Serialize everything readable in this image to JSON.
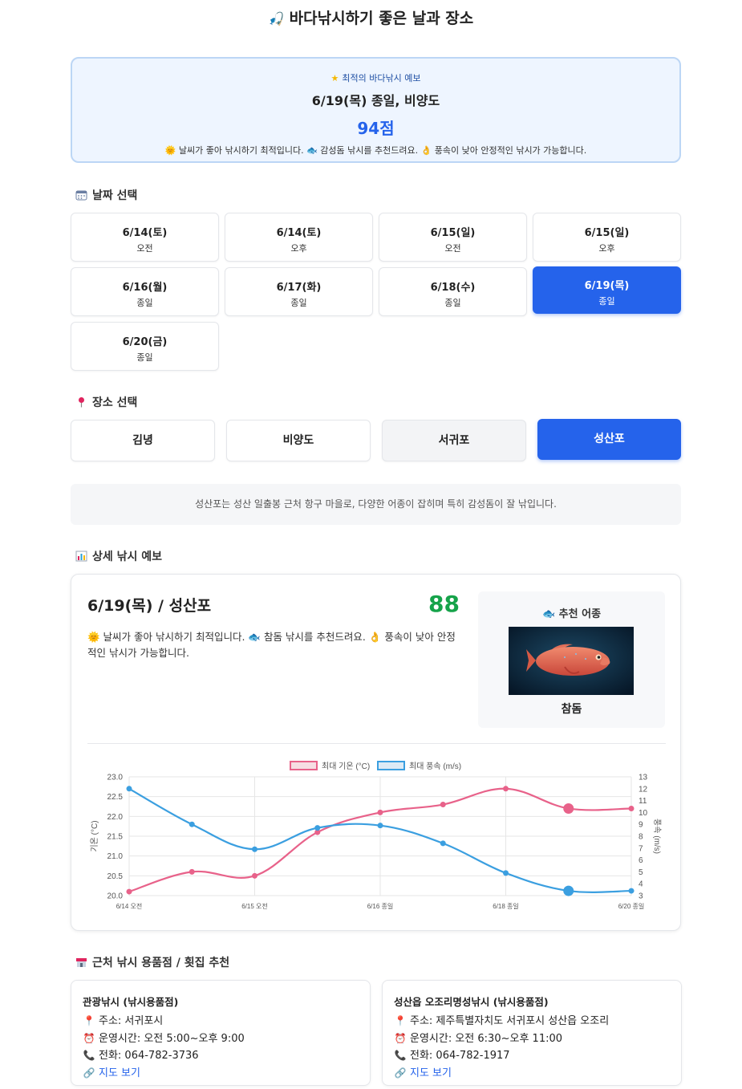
{
  "page": {
    "title": "바다낚시하기 좋은 날과 장소",
    "title_icon": "person-fishing-icon"
  },
  "best": {
    "label": "최적의 바다낚시 예보",
    "title": "6/19(목) 종일, 비양도",
    "score": "94점",
    "desc": "🌞 날씨가 좋아 낚시하기 최적입니다. 🐟 감성돔 낚시를 추천드려요. 👌 풍속이 낮아 안정적인 낚시가 가능합니다."
  },
  "date_section": {
    "title": "날짜 선택"
  },
  "dates": [
    {
      "date": "6/14(토)",
      "time": "오전",
      "active": false
    },
    {
      "date": "6/14(토)",
      "time": "오후",
      "active": false
    },
    {
      "date": "6/15(일)",
      "time": "오전",
      "active": false
    },
    {
      "date": "6/15(일)",
      "time": "오후",
      "active": false
    },
    {
      "date": "6/16(월)",
      "time": "종일",
      "active": false
    },
    {
      "date": "6/17(화)",
      "time": "종일",
      "active": false
    },
    {
      "date": "6/18(수)",
      "time": "종일",
      "active": false
    },
    {
      "date": "6/19(목)",
      "time": "종일",
      "active": true
    },
    {
      "date": "6/20(금)",
      "time": "종일",
      "active": false
    }
  ],
  "location_section": {
    "title": "장소 선택"
  },
  "locations": [
    {
      "name": "김녕",
      "state": "default"
    },
    {
      "name": "비양도",
      "state": "default"
    },
    {
      "name": "서귀포",
      "state": "hover"
    },
    {
      "name": "성산포",
      "state": "active"
    }
  ],
  "location_desc": "성산포는 성산 일출봉 근처 항구 마을로, 다양한 어종이 잡히며 특히 감성돔이 잘 낚입니다.",
  "detail_section": {
    "title": "상세 낚시 예보"
  },
  "detail": {
    "title": "6/19(목) / 성산포",
    "score": "88",
    "desc": "🌞 날씨가 좋아 낚시하기 최적입니다. 🐟 참돔 낚시를 추천드려요. 👌 풍속이 낮아 안정적인 낚시가 가능합니다.",
    "rec_title": "🐟 추천 어종",
    "rec_fish": "참돔"
  },
  "chart_data": {
    "type": "line",
    "x": [
      "6/14 오전",
      "6/14 오후",
      "6/15 오전",
      "6/15 오후",
      "6/16 종일",
      "6/17 종일",
      "6/18 종일",
      "6/19 종일",
      "6/20 종일"
    ],
    "x_tick_labels": [
      "6/14 오전",
      "6/15 오전",
      "6/16 종일",
      "6/18 종일",
      "6/20 종일"
    ],
    "series": [
      {
        "name": "최대 기온 (°C)",
        "axis": "left",
        "color": "#e8628a",
        "values": [
          20.1,
          20.6,
          20.5,
          21.6,
          22.1,
          22.3,
          22.7,
          22.2,
          22.2
        ]
      },
      {
        "name": "최대 풍속 (m/s)",
        "axis": "right",
        "color": "#3b9fe0",
        "values": [
          12.0,
          9.0,
          6.9,
          8.7,
          8.9,
          7.4,
          4.9,
          3.4,
          3.4
        ]
      }
    ],
    "highlight_index": 7,
    "ylabel_left": "기온 (°C)",
    "ylabel_right": "풍속 (m/s)",
    "ylim_left": [
      20.0,
      23.0
    ],
    "ylim_right": [
      3,
      13
    ],
    "yticks_left": [
      "23.0",
      "22.5",
      "22.0",
      "21.5",
      "21.0",
      "20.5",
      "20.0"
    ],
    "yticks_right": [
      "13",
      "12",
      "11",
      "10",
      "9",
      "8",
      "7",
      "6",
      "5",
      "4",
      "3"
    ],
    "legend_position": "top",
    "grid": true
  },
  "store_section": {
    "title": "근처 낚시 용품점 / 횟집 추천"
  },
  "stores": [
    {
      "name": "관광낚시 (낚시용품점)",
      "address": "주소: 서귀포시",
      "hours": "운영시간: 오전 5:00~오후 9:00",
      "phone": "전화: 064-782-3736",
      "map_link": "지도 보기"
    },
    {
      "name": "성산읍 오조리명성낚시 (낚시용품점)",
      "address": "주소: 제주특별자치도 서귀포시 성산읍 오조리",
      "hours": "운영시간: 오전 6:30~오후 11:00",
      "phone": "전화: 064-782-1917",
      "map_link": "지도 보기"
    }
  ]
}
